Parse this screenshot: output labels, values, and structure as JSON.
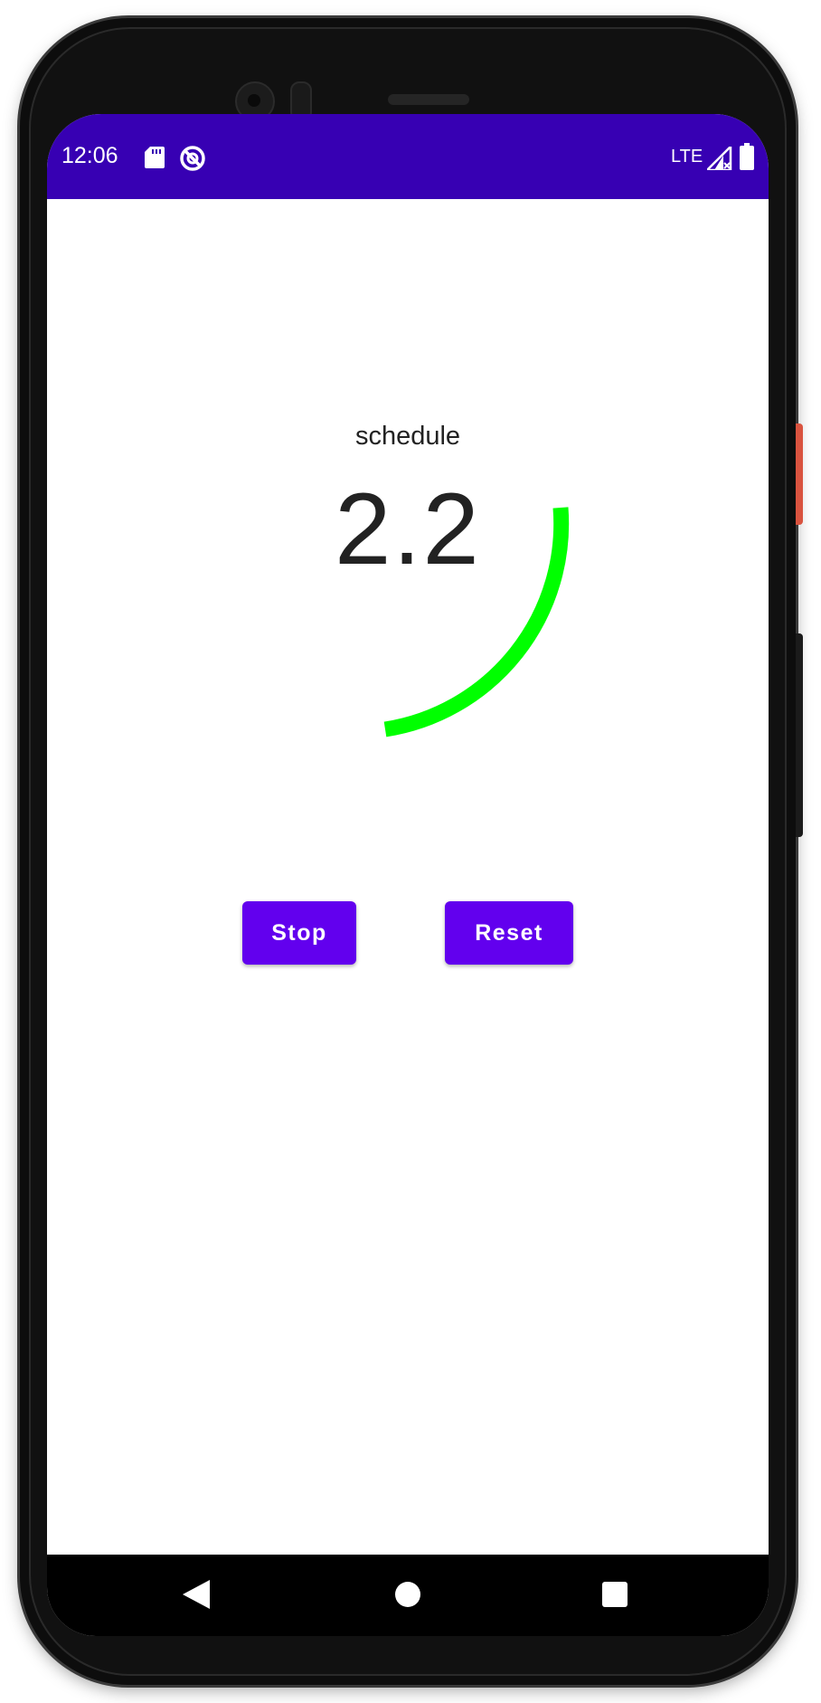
{
  "status_bar": {
    "time": "12:06",
    "network_label": "LTE",
    "icons": [
      "sd-card-icon",
      "sync-icon",
      "signal-icon",
      "battery-icon"
    ],
    "background_color": "#3700b3"
  },
  "main": {
    "label": "schedule",
    "value": "2.2",
    "arc_color": "#00ff00"
  },
  "buttons": {
    "stop_label": "Stop",
    "reset_label": "Reset",
    "color": "#6200ee"
  },
  "nav_bar": {
    "icons": [
      "back-icon",
      "home-icon",
      "recents-icon"
    ]
  }
}
